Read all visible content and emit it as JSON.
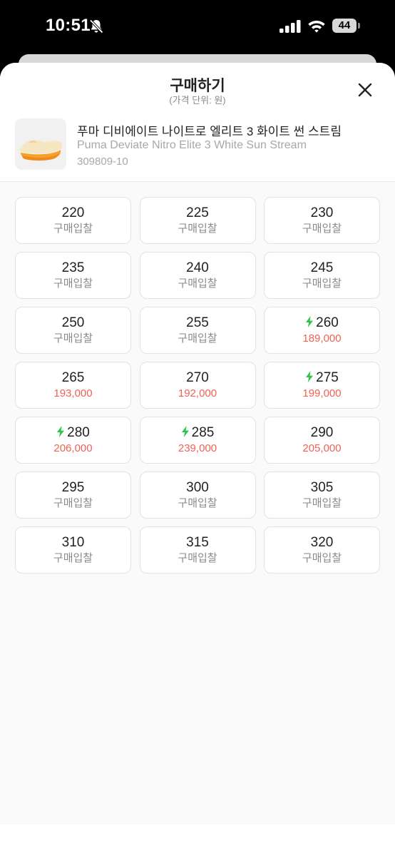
{
  "status_bar": {
    "time": "10:51",
    "battery": "44",
    "icons": [
      "bell-off-icon",
      "signal-icon",
      "wifi-icon",
      "battery-icon"
    ]
  },
  "sheet": {
    "title": "구매하기",
    "subtitle": "(가격 단위: 원)",
    "close_icon": "close-icon"
  },
  "product": {
    "name_ko": "푸마 디비에이트 나이트로 엘리트 3 화이트 썬 스트림",
    "name_en": "Puma Deviate Nitro Elite 3 White Sun Stream",
    "code": "309809-10"
  },
  "colors": {
    "price_red": "#ef6253",
    "bolt_green": "#2fc44d",
    "bid_gray": "#8a8a8a"
  },
  "sizes": [
    {
      "size": "220",
      "price": "구매입찰",
      "fast": false,
      "has_price": false
    },
    {
      "size": "225",
      "price": "구매입찰",
      "fast": false,
      "has_price": false
    },
    {
      "size": "230",
      "price": "구매입찰",
      "fast": false,
      "has_price": false
    },
    {
      "size": "235",
      "price": "구매입찰",
      "fast": false,
      "has_price": false
    },
    {
      "size": "240",
      "price": "구매입찰",
      "fast": false,
      "has_price": false
    },
    {
      "size": "245",
      "price": "구매입찰",
      "fast": false,
      "has_price": false
    },
    {
      "size": "250",
      "price": "구매입찰",
      "fast": false,
      "has_price": false
    },
    {
      "size": "255",
      "price": "구매입찰",
      "fast": false,
      "has_price": false
    },
    {
      "size": "260",
      "price": "189,000",
      "fast": true,
      "has_price": true
    },
    {
      "size": "265",
      "price": "193,000",
      "fast": false,
      "has_price": true
    },
    {
      "size": "270",
      "price": "192,000",
      "fast": false,
      "has_price": true
    },
    {
      "size": "275",
      "price": "199,000",
      "fast": true,
      "has_price": true
    },
    {
      "size": "280",
      "price": "206,000",
      "fast": true,
      "has_price": true
    },
    {
      "size": "285",
      "price": "239,000",
      "fast": true,
      "has_price": true
    },
    {
      "size": "290",
      "price": "205,000",
      "fast": false,
      "has_price": true
    },
    {
      "size": "295",
      "price": "구매입찰",
      "fast": false,
      "has_price": false
    },
    {
      "size": "300",
      "price": "구매입찰",
      "fast": false,
      "has_price": false
    },
    {
      "size": "305",
      "price": "구매입찰",
      "fast": false,
      "has_price": false
    },
    {
      "size": "310",
      "price": "구매입찰",
      "fast": false,
      "has_price": false
    },
    {
      "size": "315",
      "price": "구매입찰",
      "fast": false,
      "has_price": false
    },
    {
      "size": "320",
      "price": "구매입찰",
      "fast": false,
      "has_price": false
    }
  ]
}
